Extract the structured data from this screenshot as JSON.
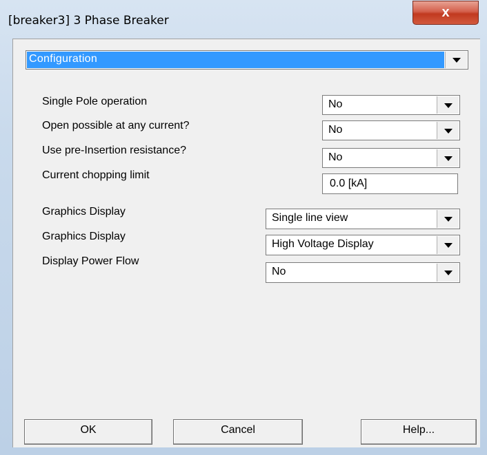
{
  "window": {
    "title": "[breaker3] 3 Phase Breaker",
    "close_label": "x"
  },
  "section_select": {
    "value": "Configuration"
  },
  "fields": [
    {
      "label": "Single Pole operation",
      "value": "No"
    },
    {
      "label": "Open possible at any current?",
      "value": "No"
    },
    {
      "label": "Use pre-Insertion resistance?",
      "value": "No"
    },
    {
      "label": "Current chopping limit",
      "value": "0.0 [kA]"
    }
  ],
  "display_fields": [
    {
      "label": "Graphics Display",
      "value": "Single line view"
    },
    {
      "label": "Graphics Display",
      "value": "High Voltage Display"
    },
    {
      "label": "Display Power Flow",
      "value": "No"
    }
  ],
  "buttons": {
    "ok": "OK",
    "cancel": "Cancel",
    "help": "Help..."
  },
  "colors": {
    "selection": "#3399ff",
    "close_button": "#c1391f"
  }
}
